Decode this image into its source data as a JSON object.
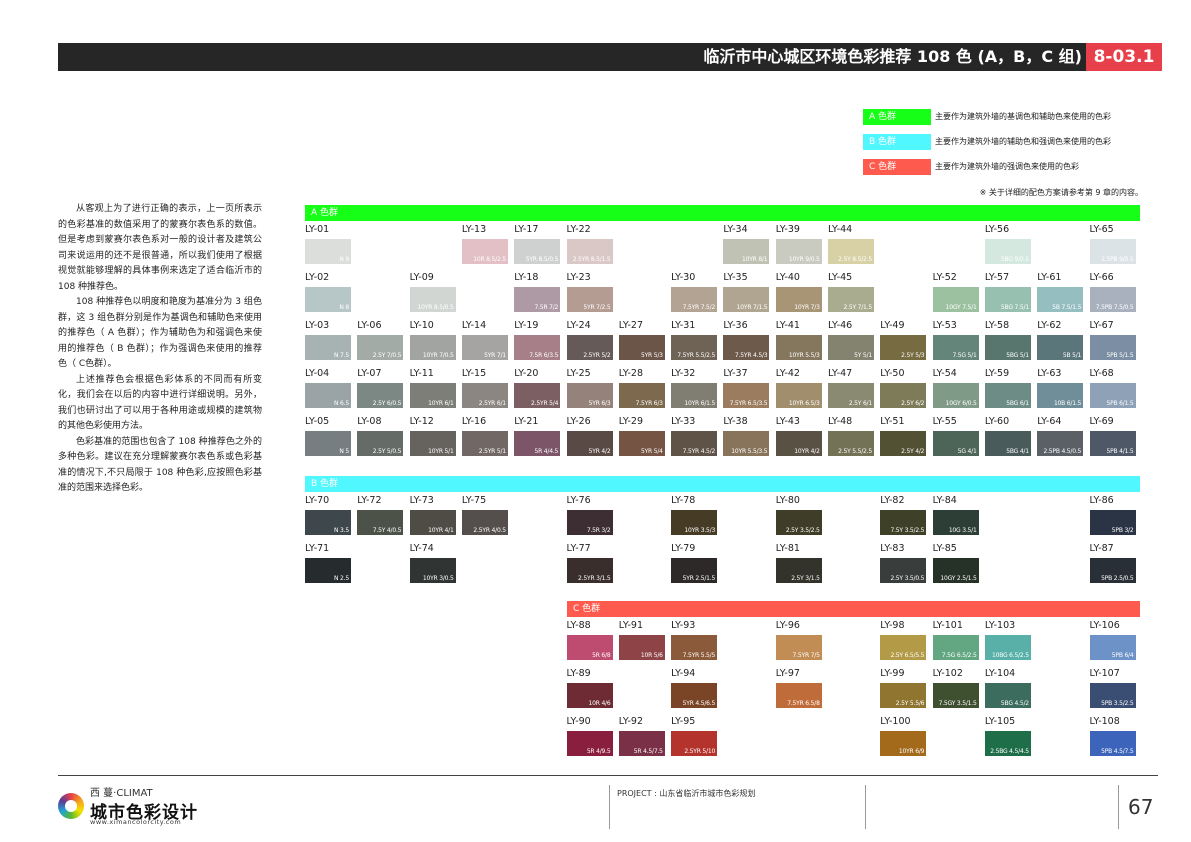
{
  "header": {
    "title": "临沂市中心城区环境色彩推荐 108 色 (A，B，C 组)",
    "code": "8-03.1"
  },
  "legend": [
    {
      "label": "A 色群",
      "color": "#16FF16",
      "desc": "主要作为建筑外墙的基调色和辅助色来使用的色彩"
    },
    {
      "label": "B 色群",
      "color": "#50F7FF",
      "desc": "主要作为建筑外墙的辅助色和强调色来使用的色彩"
    },
    {
      "label": "C 色群",
      "color": "#FF5A4E",
      "desc": "主要作为建筑外墙的强调色来使用的色彩"
    }
  ],
  "legend_note": "※ 关于详细的配色方案请参考第 9 章的内容。",
  "intro": [
    "从客观上为了进行正确的表示，上一页所表示的色彩基准的数值采用了的蒙赛尔表色系的数值。但是考虑到蒙赛尔表色系对一般的设计者及建筑公司来说运用的还不是很普通，所以我们使用了根据视觉就能够理解的具体事例来选定了适合临沂市的 108 种推荐色。",
    "108 种推荐色以明度和艳度为基准分为 3 组色群，这 3 组色群分别是作为基调色和辅助色来使用的推荐色（ A 色群）；作为辅助色为和强调色来使用的推荐色（ B 色群）；作为强调色来使用的推荐色（ C色群）。",
    "上述推荐色会根据色彩体系的不同而有所变化，我们会在以后的内容中进行详细说明。另外，我们也研讨出了可以用于各种用途或规模的建筑物的其他色彩使用方法。",
    "色彩基准的范围也包含了 108 种推荐色之外的多种色彩。建议在充分理解蒙赛尔表色系或色彩基准的情况下,不只局限于 108 种色彩,应按照色彩基准的范围来选择色彩。"
  ],
  "bands": [
    {
      "label": "A 色群",
      "color": "#16FF16"
    },
    {
      "label": "B 色群",
      "color": "#50F7FF"
    },
    {
      "label": "C 色群",
      "color": "#FF5A4E"
    }
  ],
  "colors": [
    {
      "id": "LY-01",
      "code": "N 9",
      "hex": "#DCDEDC",
      "col": 0,
      "row": 0
    },
    {
      "id": "LY-13",
      "code": "10R 8.5/2.5",
      "hex": "#E3BFC6",
      "col": 3,
      "row": 0
    },
    {
      "id": "LY-17",
      "code": "5YR 8.5/0.5",
      "hex": "#CFD1D0",
      "col": 4,
      "row": 0
    },
    {
      "id": "LY-22",
      "code": "2.5YR 8.5/1.5",
      "hex": "#DAC8C6",
      "col": 5,
      "row": 0
    },
    {
      "id": "LY-34",
      "code": "10YR 8/1",
      "hex": "#C0C3B4",
      "col": 8,
      "row": 0
    },
    {
      "id": "LY-39",
      "code": "10YR 9/0.5",
      "hex": "#C9CBC0",
      "col": 9,
      "row": 0
    },
    {
      "id": "LY-44",
      "code": "2.5Y 8.5/2.5",
      "hex": "#D7D1A5",
      "col": 10,
      "row": 0
    },
    {
      "id": "LY-56",
      "code": "5BG 9/0.5",
      "hex": "#D4E8DF",
      "col": 13,
      "row": 0
    },
    {
      "id": "LY-65",
      "code": "2.5PB 9/0.5",
      "hex": "#DCE3E7",
      "col": 15,
      "row": 0
    },
    {
      "id": "LY-02",
      "code": "N 8",
      "hex": "#B7C6C6",
      "col": 0,
      "row": 1
    },
    {
      "id": "LY-09",
      "code": "10YR 8.5/0.5",
      "hex": "#D2D6D3",
      "col": 2,
      "row": 1
    },
    {
      "id": "LY-18",
      "code": "7.5R 7/2",
      "hex": "#AE9AA5",
      "col": 4,
      "row": 1
    },
    {
      "id": "LY-23",
      "code": "5YR 7/2.5",
      "hex": "#B49C92",
      "col": 5,
      "row": 1
    },
    {
      "id": "LY-30",
      "code": "7.5YR 7.5/2",
      "hex": "#B2A393",
      "col": 7,
      "row": 1
    },
    {
      "id": "LY-35",
      "code": "10YR 7/1.5",
      "hex": "#B0A590",
      "col": 8,
      "row": 1
    },
    {
      "id": "LY-40",
      "code": "10YR 7/3",
      "hex": "#A89575",
      "col": 9,
      "row": 1
    },
    {
      "id": "LY-45",
      "code": "2.5Y 7/1.5",
      "hex": "#AAAC90",
      "col": 10,
      "row": 1
    },
    {
      "id": "LY-52",
      "code": "10GY 7.5/1",
      "hex": "#9BC1A0",
      "col": 12,
      "row": 1
    },
    {
      "id": "LY-57",
      "code": "5BG 7.5/1",
      "hex": "#97C0B0",
      "col": 13,
      "row": 1
    },
    {
      "id": "LY-61",
      "code": "5B 7.5/1.5",
      "hex": "#95BEC0",
      "col": 14,
      "row": 1
    },
    {
      "id": "LY-66",
      "code": "7.5PB 7.5/0.5",
      "hex": "#A9B1BE",
      "col": 15,
      "row": 1
    },
    {
      "id": "LY-03",
      "code": "N 7.5",
      "hex": "#A7B2B2",
      "col": 0,
      "row": 2
    },
    {
      "id": "LY-06",
      "code": "2.5Y 7/0.5",
      "hex": "#A3ABA6",
      "col": 1,
      "row": 2
    },
    {
      "id": "LY-10",
      "code": "10YR 7/0.5",
      "hex": "#A2A4A1",
      "col": 2,
      "row": 2
    },
    {
      "id": "LY-14",
      "code": "5YR 7/1",
      "hex": "#A5A4A3",
      "col": 3,
      "row": 2
    },
    {
      "id": "LY-19",
      "code": "7.5R 6/3.5",
      "hex": "#A77F88",
      "col": 4,
      "row": 2
    },
    {
      "id": "LY-24",
      "code": "2.5YR 5/2",
      "hex": "#655A58",
      "col": 5,
      "row": 2
    },
    {
      "id": "LY-27",
      "code": "5YR 5/3",
      "hex": "#6B5549",
      "col": 6,
      "row": 2
    },
    {
      "id": "LY-31",
      "code": "7.5YR 5.5/2.5",
      "hex": "#6E6354",
      "col": 7,
      "row": 2
    },
    {
      "id": "LY-36",
      "code": "7.5YR 4.5/3",
      "hex": "#6E5A4B",
      "col": 8,
      "row": 2
    },
    {
      "id": "LY-41",
      "code": "10YR 5.5/3",
      "hex": "#85775D",
      "col": 9,
      "row": 2
    },
    {
      "id": "LY-46",
      "code": "5Y 5/1",
      "hex": "#84836F",
      "col": 10,
      "row": 2
    },
    {
      "id": "LY-49",
      "code": "2.5Y 5/3",
      "hex": "#776B41",
      "col": 11,
      "row": 2
    },
    {
      "id": "LY-53",
      "code": "7.5G 5/1",
      "hex": "#63857A",
      "col": 12,
      "row": 2
    },
    {
      "id": "LY-58",
      "code": "5BG 5/1",
      "hex": "#58756E",
      "col": 13,
      "row": 2
    },
    {
      "id": "LY-62",
      "code": "5B 5/1",
      "hex": "#5A767B",
      "col": 14,
      "row": 2
    },
    {
      "id": "LY-67",
      "code": "5PB 5/1.5",
      "hex": "#7C8EA3",
      "col": 15,
      "row": 2
    },
    {
      "id": "LY-04",
      "code": "N 6.5",
      "hex": "#9AA3A5",
      "col": 0,
      "row": 3
    },
    {
      "id": "LY-07",
      "code": "2.5Y 6/0.5",
      "hex": "#7C8883",
      "col": 1,
      "row": 3
    },
    {
      "id": "LY-11",
      "code": "10YR 6/1",
      "hex": "#7E7E78",
      "col": 2,
      "row": 3
    },
    {
      "id": "LY-15",
      "code": "2.5YR 6/1",
      "hex": "#8C8682",
      "col": 3,
      "row": 3
    },
    {
      "id": "LY-20",
      "code": "2.5YR 5/4",
      "hex": "#7C5F63",
      "col": 4,
      "row": 3
    },
    {
      "id": "LY-25",
      "code": "5YR 6/3",
      "hex": "#95837B",
      "col": 5,
      "row": 3
    },
    {
      "id": "LY-28",
      "code": "7.5YR 6/3",
      "hex": "#7D6A4E",
      "col": 6,
      "row": 3
    },
    {
      "id": "LY-32",
      "code": "10YR 6/1.5",
      "hex": "#807D72",
      "col": 7,
      "row": 3
    },
    {
      "id": "LY-37",
      "code": "7.5YR 6.5/3.5",
      "hex": "#9B7C5E",
      "col": 8,
      "row": 3
    },
    {
      "id": "LY-42",
      "code": "10YR 6.5/3",
      "hex": "#A08E6D",
      "col": 9,
      "row": 3
    },
    {
      "id": "LY-47",
      "code": "2.5Y 6/1",
      "hex": "#8A8971",
      "col": 10,
      "row": 3
    },
    {
      "id": "LY-50",
      "code": "2.5Y 6/2",
      "hex": "#7E7C58",
      "col": 11,
      "row": 3
    },
    {
      "id": "LY-54",
      "code": "10GY 6/0.5",
      "hex": "#7F9A86",
      "col": 12,
      "row": 3
    },
    {
      "id": "LY-59",
      "code": "5BG 6/1",
      "hex": "#6E8C86",
      "col": 13,
      "row": 3
    },
    {
      "id": "LY-63",
      "code": "10B 6/1.5",
      "hex": "#6F8E99",
      "col": 14,
      "row": 3
    },
    {
      "id": "LY-68",
      "code": "5PB 6/1.5",
      "hex": "#8EA1B7",
      "col": 15,
      "row": 3
    },
    {
      "id": "LY-05",
      "code": "N 5",
      "hex": "#777E82",
      "col": 0,
      "row": 4
    },
    {
      "id": "LY-08",
      "code": "2.5Y 5/0.5",
      "hex": "#656C68",
      "col": 1,
      "row": 4
    },
    {
      "id": "LY-12",
      "code": "10YR 5/1",
      "hex": "#66635F",
      "col": 2,
      "row": 4
    },
    {
      "id": "LY-16",
      "code": "2.5YR 5/1",
      "hex": "#716866",
      "col": 3,
      "row": 4
    },
    {
      "id": "LY-21",
      "code": "5R 4/4.5",
      "hex": "#7C5568",
      "col": 4,
      "row": 4
    },
    {
      "id": "LY-26",
      "code": "5YR 4/2",
      "hex": "#5A4A45",
      "col": 5,
      "row": 4
    },
    {
      "id": "LY-29",
      "code": "5YR 5/4",
      "hex": "#765443",
      "col": 6,
      "row": 4
    },
    {
      "id": "LY-33",
      "code": "7.5YR 4.5/2",
      "hex": "#5F5347",
      "col": 7,
      "row": 4
    },
    {
      "id": "LY-38",
      "code": "10YR 5.5/3.5",
      "hex": "#88745A",
      "col": 8,
      "row": 4
    },
    {
      "id": "LY-43",
      "code": "10YR 4/2",
      "hex": "#5A5145",
      "col": 9,
      "row": 4
    },
    {
      "id": "LY-48",
      "code": "2.5Y 5.5/2.5",
      "hex": "#737257",
      "col": 10,
      "row": 4
    },
    {
      "id": "LY-51",
      "code": "2.5Y 4/2",
      "hex": "#525134",
      "col": 11,
      "row": 4
    },
    {
      "id": "LY-55",
      "code": "5G 4/1",
      "hex": "#4D6458",
      "col": 12,
      "row": 4
    },
    {
      "id": "LY-60",
      "code": "5BG 4/1",
      "hex": "#495B5A",
      "col": 13,
      "row": 4
    },
    {
      "id": "LY-64",
      "code": "2.5PB 4.5/0.5",
      "hex": "#5A6066",
      "col": 14,
      "row": 4
    },
    {
      "id": "LY-69",
      "code": "5PB 4/1.5",
      "hex": "#4E5867",
      "col": 15,
      "row": 4
    },
    {
      "id": "LY-70",
      "code": "N 3.5",
      "hex": "#3D474C",
      "col": 0,
      "row": 5
    },
    {
      "id": "LY-72",
      "code": "7.5Y 4/0.5",
      "hex": "#4D5249",
      "col": 1,
      "row": 5
    },
    {
      "id": "LY-73",
      "code": "10YR 4/1",
      "hex": "#4F4C45",
      "col": 2,
      "row": 5
    },
    {
      "id": "LY-75",
      "code": "2.5YR 4/0.5",
      "hex": "#544F4C",
      "col": 3,
      "row": 5
    },
    {
      "id": "LY-76",
      "code": "7.5R 3/2",
      "hex": "#3D2E33",
      "col": 5,
      "row": 5
    },
    {
      "id": "LY-78",
      "code": "10YR 3.5/3",
      "hex": "#463B25",
      "col": 7,
      "row": 5
    },
    {
      "id": "LY-80",
      "code": "2.5Y 3.5/2.5",
      "hex": "#3F3D27",
      "col": 9,
      "row": 5
    },
    {
      "id": "LY-82",
      "code": "7.5Y 3.5/2.5",
      "hex": "#3E4128",
      "col": 11,
      "row": 5
    },
    {
      "id": "LY-84",
      "code": "10G 3.5/1",
      "hex": "#2C3E36",
      "col": 12,
      "row": 5
    },
    {
      "id": "LY-86",
      "code": "5PB 3/2",
      "hex": "#2B3445",
      "col": 15,
      "row": 5
    },
    {
      "id": "LY-71",
      "code": "N 2.5",
      "hex": "#262B2E",
      "col": 0,
      "row": 6
    },
    {
      "id": "LY-74",
      "code": "10YR 3/0.5",
      "hex": "#303433",
      "col": 2,
      "row": 6
    },
    {
      "id": "LY-77",
      "code": "2.5YR 3/1.5",
      "hex": "#3A2E2D",
      "col": 5,
      "row": 6
    },
    {
      "id": "LY-79",
      "code": "5YR 2.5/1.5",
      "hex": "#2E2929",
      "col": 7,
      "row": 6
    },
    {
      "id": "LY-81",
      "code": "2.5Y 3/1.5",
      "hex": "#33332B",
      "col": 9,
      "row": 6
    },
    {
      "id": "LY-83",
      "code": "2.5Y 3.5/0.5",
      "hex": "#393D3B",
      "col": 11,
      "row": 6
    },
    {
      "id": "LY-85",
      "code": "10GY 2.5/1.5",
      "hex": "#263128",
      "col": 12,
      "row": 6
    },
    {
      "id": "LY-87",
      "code": "5PB 2.5/0.5",
      "hex": "#282F37",
      "col": 15,
      "row": 6
    },
    {
      "id": "LY-88",
      "code": "5R 6/8",
      "hex": "#BE4B70",
      "col": 5,
      "row": 7
    },
    {
      "id": "LY-91",
      "code": "10R 5/6",
      "hex": "#8E4447",
      "col": 6,
      "row": 7
    },
    {
      "id": "LY-93",
      "code": "7.5YR 5.5/5",
      "hex": "#8A5A3A",
      "col": 7,
      "row": 7
    },
    {
      "id": "LY-96",
      "code": "7.5YR 7/5",
      "hex": "#C28C55",
      "col": 9,
      "row": 7
    },
    {
      "id": "LY-98",
      "code": "2.5Y 6.5/5.5",
      "hex": "#B29A47",
      "col": 11,
      "row": 7
    },
    {
      "id": "LY-101",
      "code": "7.5G 6.5/2.5",
      "hex": "#62A782",
      "col": 12,
      "row": 7
    },
    {
      "id": "LY-103",
      "code": "10BG 6.5/2.5",
      "hex": "#58B0A8",
      "col": 13,
      "row": 7
    },
    {
      "id": "LY-106",
      "code": "5PB 6/4",
      "hex": "#6D92C7",
      "col": 15,
      "row": 7
    },
    {
      "id": "LY-89",
      "code": "10R 4/6",
      "hex": "#6E2B33",
      "col": 5,
      "row": 8
    },
    {
      "id": "LY-94",
      "code": "5YR 4.5/6.5",
      "hex": "#7A4527",
      "col": 7,
      "row": 8
    },
    {
      "id": "LY-97",
      "code": "7.5YR 6.5/8",
      "hex": "#C06C3A",
      "col": 9,
      "row": 8
    },
    {
      "id": "LY-99",
      "code": "2.5Y 5.5/6",
      "hex": "#8F7530",
      "col": 11,
      "row": 8
    },
    {
      "id": "LY-102",
      "code": "7.5GY 3.5/1.5",
      "hex": "#3F5031",
      "col": 12,
      "row": 8
    },
    {
      "id": "LY-104",
      "code": "5BG 4.5/2",
      "hex": "#3B6C5E",
      "col": 13,
      "row": 8
    },
    {
      "id": "LY-107",
      "code": "5PB 3.5/2.5",
      "hex": "#3A4E73",
      "col": 15,
      "row": 8
    },
    {
      "id": "LY-90",
      "code": "5R 4/9.5",
      "hex": "#8A1E3E",
      "col": 5,
      "row": 9
    },
    {
      "id": "LY-92",
      "code": "5R 4.5/7.5",
      "hex": "#7A3046",
      "col": 6,
      "row": 9
    },
    {
      "id": "LY-95",
      "code": "2.5YR 5/10",
      "hex": "#B4342D",
      "col": 7,
      "row": 9
    },
    {
      "id": "LY-100",
      "code": "10YR 6/9",
      "hex": "#A46A1C",
      "col": 11,
      "row": 9
    },
    {
      "id": "LY-105",
      "code": "2.5BG 4.5/4.5",
      "hex": "#1F6E4A",
      "col": 13,
      "row": 9
    },
    {
      "id": "LY-108",
      "code": "5PB 4.5/7.5",
      "hex": "#3B64BA",
      "col": 15,
      "row": 9
    }
  ],
  "footer": {
    "logo_sub": "西 蔓·CLIMAT",
    "logo_main": "城市色彩设计",
    "logo_url": "www.ximancolorcity.com",
    "project": "PROJECT : 山东省临沂市城市色彩规划",
    "page": "67"
  }
}
